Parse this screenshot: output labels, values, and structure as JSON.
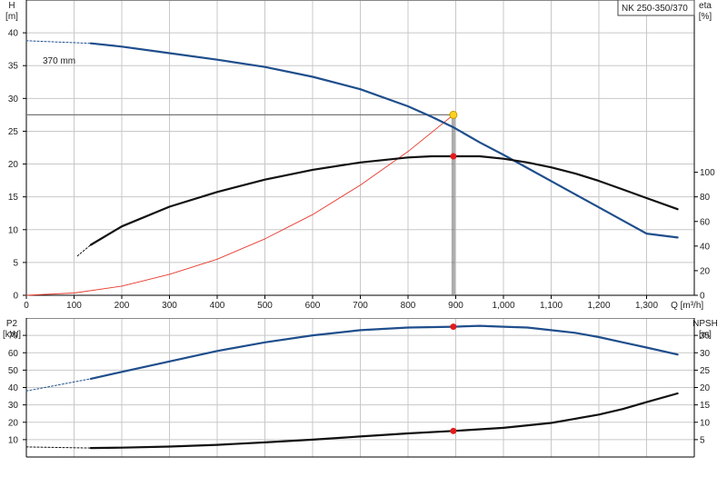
{
  "model_label": "NK 250-350/370",
  "colors": {
    "head": "#1f4e8c",
    "eta": "#111111",
    "system": "#e8382b",
    "op_point": "#ffd21f",
    "op_red": "#e31b1b",
    "guide": "#777777"
  },
  "chart_data": [
    {
      "type": "line",
      "title": "",
      "xlabel": "Q [m³/h]",
      "ylabel_left_unit": "H",
      "ylabel_left_sub": "[m]",
      "ylabel_right_unit": "eta",
      "ylabel_right_sub": "[%]",
      "xlim": [
        0,
        1400
      ],
      "ylim_left": [
        0,
        45
      ],
      "ylim_right": [
        0,
        240
      ],
      "x_ticks": [
        {
          "v": 0,
          "label": "0"
        },
        {
          "v": 100,
          "label": "100"
        },
        {
          "v": 200,
          "label": "200"
        },
        {
          "v": 300,
          "label": "300"
        },
        {
          "v": 400,
          "label": "400"
        },
        {
          "v": 500,
          "label": "500"
        },
        {
          "v": 600,
          "label": "600"
        },
        {
          "v": 700,
          "label": "700"
        },
        {
          "v": 800,
          "label": "800"
        },
        {
          "v": 900,
          "label": "900"
        },
        {
          "v": 1000,
          "label": "1,000"
        },
        {
          "v": 1100,
          "label": "1,100"
        },
        {
          "v": 1200,
          "label": "1,200"
        },
        {
          "v": 1300,
          "label": "1,300"
        }
      ],
      "y_left_ticks": [
        "0",
        "5",
        "10",
        "15",
        "20",
        "25",
        "30",
        "35",
        "40"
      ],
      "y_right_ticks": [
        "0",
        "20",
        "40",
        "60",
        "80",
        "100"
      ],
      "curve_label": "370 mm",
      "grid": true,
      "series": [
        {
          "axis": "left",
          "style": "solid",
          "x": [
            135,
            200,
            300,
            400,
            500,
            600,
            700,
            800,
            850,
            895,
            950,
            1000,
            1050,
            1100,
            1150,
            1200,
            1250,
            1300,
            1365
          ],
          "y": [
            38.4,
            37.9,
            36.9,
            35.9,
            34.8,
            33.3,
            31.4,
            28.8,
            27.2,
            25.6,
            23.3,
            21.4,
            19.4,
            17.4,
            15.4,
            13.4,
            11.4,
            9.4,
            8.8
          ]
        },
        {
          "axis": "left",
          "style": "dashed",
          "x": [
            0,
            135
          ],
          "y": [
            38.8,
            38.4
          ]
        },
        {
          "axis": "right",
          "style": "solid",
          "x": [
            135,
            200,
            300,
            400,
            500,
            600,
            700,
            800,
            850,
            895,
            950,
            1000,
            1050,
            1100,
            1150,
            1200,
            1250,
            1300,
            1365
          ],
          "y": [
            41,
            56,
            72,
            84,
            94,
            102,
            108,
            112,
            113,
            113,
            113,
            111,
            108,
            104,
            99,
            93,
            86,
            79,
            70
          ]
        },
        {
          "axis": "right",
          "style": "dashed",
          "x": [
            107,
            135
          ],
          "y": [
            32,
            41
          ]
        },
        {
          "axis": "left",
          "style": "system",
          "x": [
            0,
            100,
            200,
            300,
            400,
            500,
            600,
            700,
            800,
            895
          ],
          "y": [
            0,
            0.35,
            1.4,
            3.2,
            5.5,
            8.6,
            12.3,
            16.8,
            21.9,
            27.5
          ]
        }
      ],
      "operating_point": {
        "x": 895,
        "head": 27.5,
        "eta": 113
      }
    },
    {
      "type": "line",
      "title": "",
      "xlabel": "",
      "ylabel_left_unit": "P2",
      "ylabel_left_sub": "[kW]",
      "ylabel_right_unit": "NPSH",
      "ylabel_right_sub": "[m]",
      "xlim": [
        0,
        1400
      ],
      "ylim_left": [
        0,
        80
      ],
      "ylim_right": [
        0,
        40
      ],
      "y_left_ticks": [
        "10",
        "20",
        "30",
        "40",
        "50",
        "60",
        "70"
      ],
      "y_right_ticks": [
        "5",
        "10",
        "15",
        "20",
        "25",
        "30",
        "35"
      ],
      "grid": true,
      "series": [
        {
          "axis": "left",
          "style": "solid",
          "x": [
            135,
            200,
            300,
            400,
            500,
            600,
            700,
            800,
            895,
            950,
            1000,
            1050,
            1100,
            1150,
            1200,
            1250,
            1300,
            1365
          ],
          "y": [
            45,
            49,
            55,
            61,
            66,
            70,
            73,
            74.5,
            75,
            75.5,
            75,
            74.5,
            73,
            71.5,
            69,
            66,
            63,
            59
          ]
        },
        {
          "axis": "left",
          "style": "dashed",
          "x": [
            0,
            135
          ],
          "y": [
            38,
            45
          ]
        },
        {
          "axis": "right",
          "style": "solid",
          "x": [
            135,
            200,
            300,
            400,
            500,
            600,
            700,
            800,
            895,
            1000,
            1100,
            1150,
            1200,
            1250,
            1300,
            1365
          ],
          "y": [
            2.6,
            2.7,
            3.0,
            3.5,
            4.2,
            5.0,
            5.9,
            6.8,
            7.5,
            8.4,
            9.8,
            11.0,
            12.2,
            13.8,
            15.8,
            18.3
          ]
        },
        {
          "axis": "right",
          "style": "dashed",
          "x": [
            0,
            135
          ],
          "y": [
            2.9,
            2.6
          ]
        }
      ],
      "operating_point": {
        "x": 895,
        "power": 75,
        "npsh": 7.5
      }
    }
  ]
}
